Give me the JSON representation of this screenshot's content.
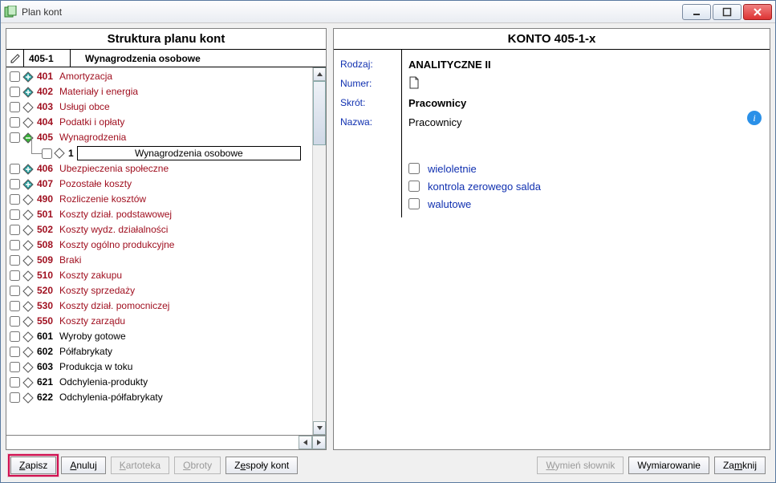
{
  "window": {
    "title": "Plan kont"
  },
  "left": {
    "title": "Struktura planu kont",
    "header_code": "405-1",
    "header_name": "Wynagrodzenia osobowe",
    "child": {
      "num": "1",
      "label": "Wynagrodzenia osobowe"
    },
    "items": [
      {
        "num": "401",
        "label": "Amortyzacja",
        "color": "red",
        "dia": "plus"
      },
      {
        "num": "402",
        "label": "Materiały i energia",
        "color": "red",
        "dia": "plus"
      },
      {
        "num": "403",
        "label": "Usługi obce",
        "color": "red",
        "dia": "empty"
      },
      {
        "num": "404",
        "label": "Podatki i opłaty",
        "color": "red",
        "dia": "empty"
      },
      {
        "num": "405",
        "label": "Wynagrodzenia",
        "color": "red",
        "dia": "minus",
        "expanded": true
      },
      {
        "num": "406",
        "label": "Ubezpieczenia społeczne",
        "color": "red",
        "dia": "plus"
      },
      {
        "num": "407",
        "label": "Pozostałe koszty",
        "color": "red",
        "dia": "plus"
      },
      {
        "num": "490",
        "label": "Rozliczenie kosztów",
        "color": "red",
        "dia": "empty"
      },
      {
        "num": "501",
        "label": "Koszty dział. podstawowej",
        "color": "red",
        "dia": "empty"
      },
      {
        "num": "502",
        "label": "Koszty wydz. działalności",
        "color": "red",
        "dia": "empty"
      },
      {
        "num": "508",
        "label": "Koszty ogólno produkcyjne",
        "color": "red",
        "dia": "empty"
      },
      {
        "num": "509",
        "label": "Braki",
        "color": "red",
        "dia": "empty"
      },
      {
        "num": "510",
        "label": "Koszty zakupu",
        "color": "red",
        "dia": "empty"
      },
      {
        "num": "520",
        "label": "Koszty sprzedaży",
        "color": "red",
        "dia": "empty"
      },
      {
        "num": "530",
        "label": "Koszty dział. pomocniczej",
        "color": "red",
        "dia": "empty"
      },
      {
        "num": "550",
        "label": "Koszty zarządu",
        "color": "red",
        "dia": "empty"
      },
      {
        "num": "601",
        "label": "Wyroby gotowe",
        "color": "black",
        "dia": "empty"
      },
      {
        "num": "602",
        "label": "Półfabrykaty",
        "color": "black",
        "dia": "empty"
      },
      {
        "num": "603",
        "label": "Produkcja w toku",
        "color": "black",
        "dia": "empty"
      },
      {
        "num": "621",
        "label": "Odchylenia-produkty",
        "color": "black",
        "dia": "empty"
      },
      {
        "num": "622",
        "label": "Odchylenia-półfabrykaty",
        "color": "black",
        "dia": "empty"
      }
    ]
  },
  "right": {
    "title": "KONTO  405-1-x",
    "labels": {
      "rodzaj": "Rodzaj:",
      "numer": "Numer:",
      "skrot": "Skrót:",
      "nazwa": "Nazwa:"
    },
    "rodzaj": "ANALITYCZNE    II",
    "skrot": "Pracownicy",
    "nazwa": "Pracownicy",
    "opts": [
      {
        "key": "wieloletnie",
        "label": "wieloletnie"
      },
      {
        "key": "kontrola",
        "label": "kontrola zerowego salda"
      },
      {
        "key": "walutowe",
        "label": "walutowe"
      }
    ]
  },
  "buttons": {
    "zapisz": "Zapisz",
    "zapisz_u": "Z",
    "zapisz_rest": "apisz",
    "anuluj": "Anuluj",
    "anuluj_u": "A",
    "anuluj_rest": "nuluj",
    "kartoteka": "Kartoteka",
    "kartoteka_u": "K",
    "kartoteka_rest": "artoteka",
    "obroty": "Obroty",
    "obroty_u": "O",
    "obroty_rest": "broty",
    "zespoly": "Zespoły kont",
    "zespoly_u": "e",
    "zespoly_pre": "Z",
    "zespoly_rest": "społy kont",
    "wymien": "Wymień słownik",
    "wymien_u": "W",
    "wymien_rest": "ymień słownik",
    "wymiarowanie": "Wymiarowanie",
    "zamknij": "Zamknij",
    "zamknij_u": "m",
    "zamknij_pre": "Za",
    "zamknij_rest": "knij"
  }
}
